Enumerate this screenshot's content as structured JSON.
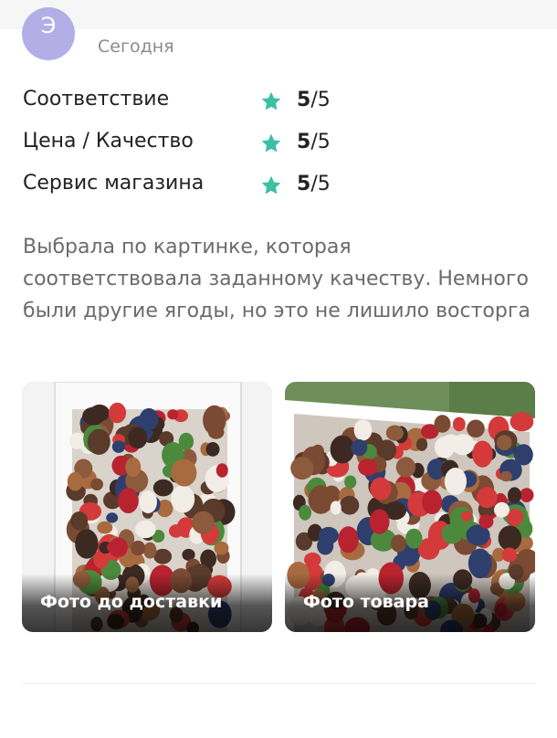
{
  "review": {
    "author_initial": "Э",
    "date": "Сегодня",
    "ratings": [
      {
        "label": "Соответствие",
        "score": "5",
        "max": "/5",
        "value": 5
      },
      {
        "label": "Цена / Качество",
        "score": "5",
        "max": "/5",
        "value": 5
      },
      {
        "label": "Сервис магазина",
        "score": "5",
        "max": "/5",
        "value": 5
      }
    ],
    "text": "Выбрала по картинке, которая соответствовала заданному качеству. Немного были другие ягоды, но это не лишило восторга",
    "photos": [
      {
        "caption": "Фото до доставки"
      },
      {
        "caption": "Фото товара"
      }
    ]
  },
  "colors": {
    "star": "#3dbfa5",
    "avatar": "#b3aee6",
    "muted_text": "#6b6b6b",
    "date_text": "#8c8c8c"
  },
  "icons": [
    "star-icon"
  ]
}
